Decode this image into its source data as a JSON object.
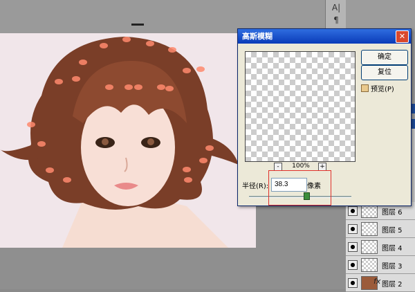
{
  "toolbar_glyphs": [
    "A|",
    "¶"
  ],
  "dialog": {
    "title": "高斯模糊",
    "ok_label": "确定",
    "reset_label": "复位",
    "preview_label": "预览(P)",
    "zoom_minus": "-",
    "zoom_level": "100%",
    "zoom_plus": "+",
    "radius_label": "半径(R):",
    "radius_value": "38.3",
    "radius_unit": "像素",
    "radius_slider_fraction": 0.57
  },
  "layers": [
    {
      "name": "图层 6"
    },
    {
      "name": "图层 5"
    },
    {
      "name": "图层 4"
    },
    {
      "name": "图层 3"
    },
    {
      "name": "图层 2"
    }
  ],
  "panel_footer": "fx",
  "colors": {
    "accent_blue": "#0a3bb8",
    "highlight_red": "#e0302a",
    "slider_green": "#3c8d3c"
  }
}
